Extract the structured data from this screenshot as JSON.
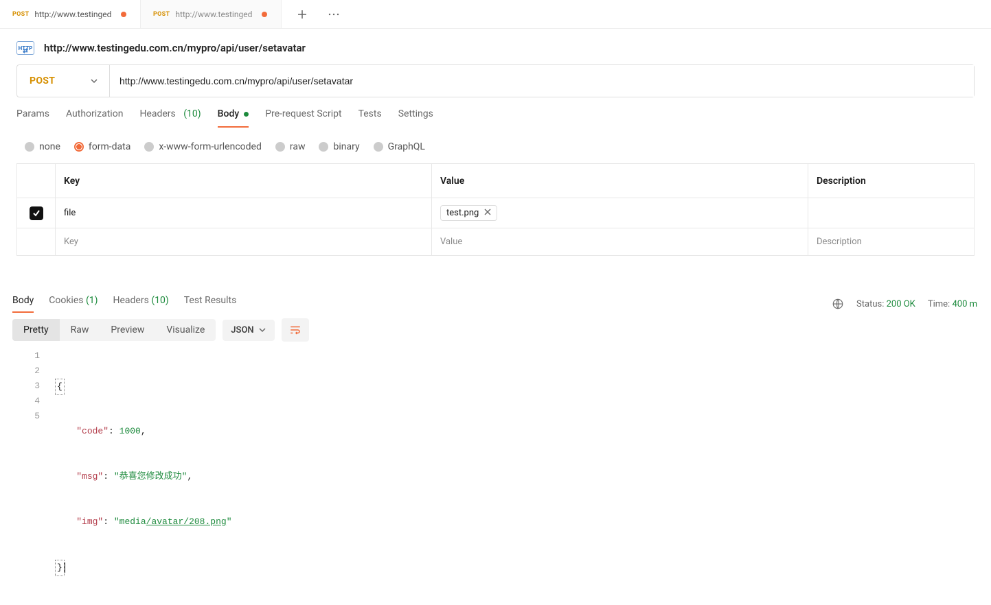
{
  "tabs": [
    {
      "method": "POST",
      "title": "http://www.testinged",
      "dirty": true,
      "active": true
    },
    {
      "method": "POST",
      "title": "http://www.testinged",
      "dirty": true,
      "active": false
    }
  ],
  "request": {
    "proto_label": "HTTP",
    "title": "http://www.testingedu.com.cn/mypro/api/user/setavatar",
    "method": "POST",
    "url": "http://www.testingedu.com.cn/mypro/api/user/setavatar"
  },
  "req_tabs": {
    "params": "Params",
    "authorization": "Authorization",
    "headers_label": "Headers",
    "headers_count": "(10)",
    "body": "Body",
    "pre_request": "Pre-request Script",
    "tests": "Tests",
    "settings": "Settings"
  },
  "body_types": {
    "none": "none",
    "form_data": "form-data",
    "urlencoded": "x-www-form-urlencoded",
    "raw": "raw",
    "binary": "binary",
    "graphql": "GraphQL"
  },
  "fd_headers": {
    "key": "Key",
    "value": "Value",
    "description": "Description"
  },
  "fd_row": {
    "key": "file",
    "file_name": "test.png",
    "desc": ""
  },
  "fd_placeholders": {
    "key": "Key",
    "value": "Value",
    "description": "Description"
  },
  "resp_tabs": {
    "body": "Body",
    "cookies_label": "Cookies",
    "cookies_count": "(1)",
    "headers_label": "Headers",
    "headers_count": "(10)",
    "test_results": "Test Results"
  },
  "resp_meta": {
    "status_label": "Status:",
    "status_value": "200 OK",
    "time_label": "Time:",
    "time_value": "400 m"
  },
  "view_modes": {
    "pretty": "Pretty",
    "raw": "Raw",
    "preview": "Preview",
    "visualize": "Visualize",
    "format": "JSON"
  },
  "code": {
    "indent": "    ",
    "open_brace": "{",
    "close_brace": "}",
    "lines": [
      {
        "n": "1"
      },
      {
        "n": "2",
        "key": "\"code\"",
        "sep": ": ",
        "num": "1000",
        "comma": ","
      },
      {
        "n": "3",
        "key": "\"msg\"",
        "sep": ": ",
        "str": "\"恭喜您修改成功\"",
        "comma": ","
      },
      {
        "n": "4",
        "key": "\"img\"",
        "sep": ": ",
        "str_pre": "\"media",
        "str_link": "/avatar/208.png",
        "str_post": "\""
      },
      {
        "n": "5"
      }
    ]
  }
}
